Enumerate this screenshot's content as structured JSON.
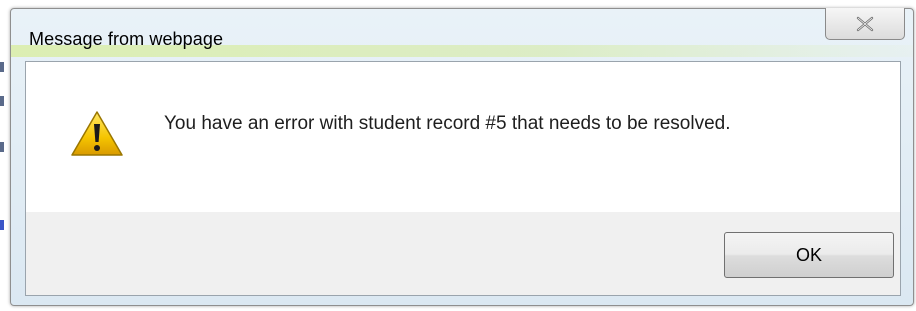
{
  "dialog": {
    "title": "Message from webpage",
    "message": "You have an error with student record #5 that needs to be resolved.",
    "ok_label": "OK",
    "close_icon": "close-icon",
    "warning_icon": "warning-icon"
  },
  "colors": {
    "warning_yellow": "#f5c400",
    "frame_blue": "#dbe8f2",
    "button_border": "#707070"
  }
}
